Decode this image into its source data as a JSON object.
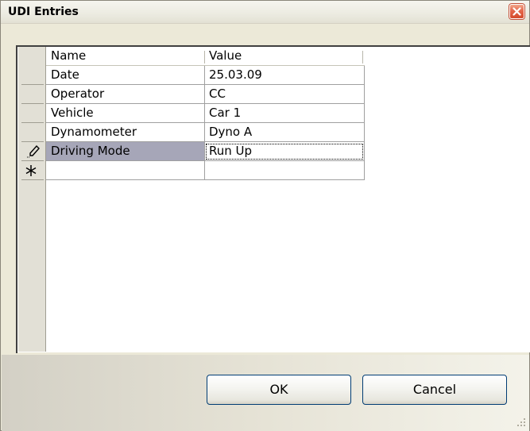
{
  "window": {
    "title": "UDI Entries"
  },
  "grid": {
    "columns": [
      "Name",
      "Value"
    ],
    "rows": [
      {
        "name": "Date",
        "value": "25.03.09"
      },
      {
        "name": "Operator",
        "value": "CC"
      },
      {
        "name": "Vehicle",
        "value": "Car 1"
      },
      {
        "name": "Dynamometer",
        "value": "Dyno A"
      },
      {
        "name": "Driving Mode",
        "value": "Run Up"
      }
    ],
    "editing_row_index": 4,
    "row_indicators": {
      "editing": "pencil-icon",
      "new_row": "asterisk-icon"
    }
  },
  "buttons": {
    "ok_label": "OK",
    "cancel_label": "Cancel"
  },
  "colors": {
    "selected_cell": "#a6a6b8",
    "close_button": "#e4664a",
    "button_border": "#003c74"
  }
}
